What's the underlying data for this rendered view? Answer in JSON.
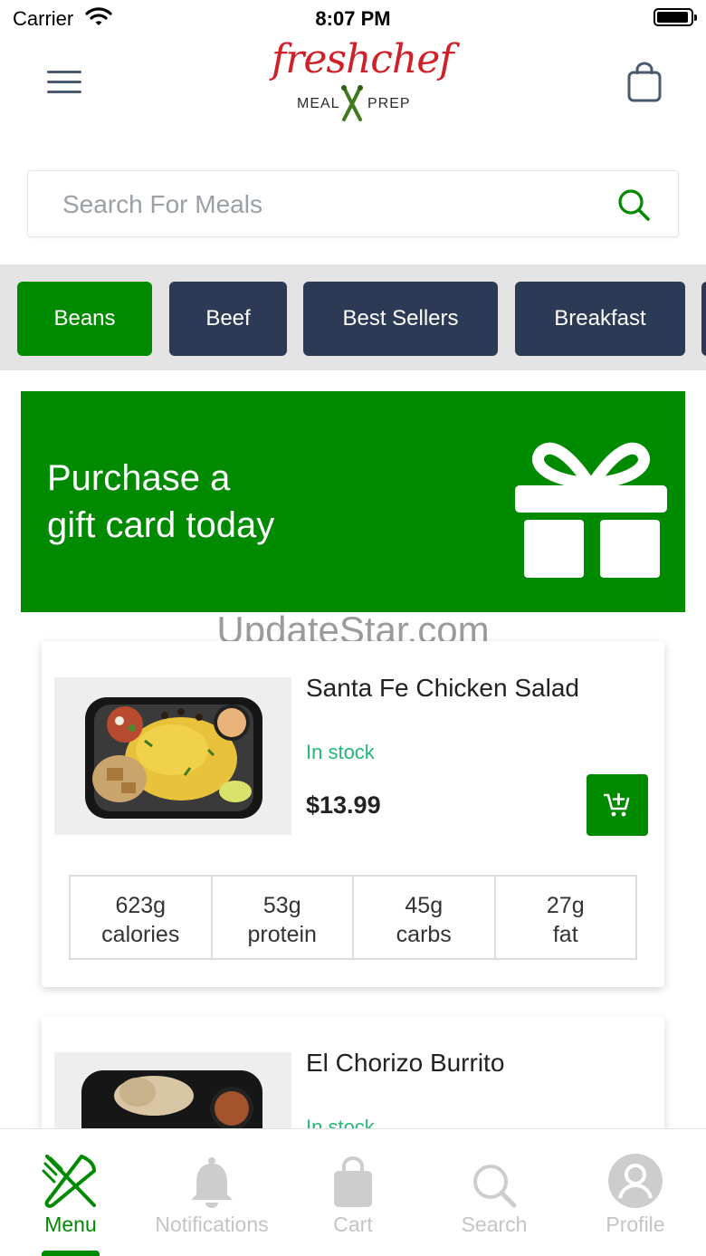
{
  "status_bar": {
    "carrier": "Carrier",
    "time": "8:07 PM"
  },
  "header": {
    "logo_text": "freshchef",
    "logo_sub_left": "MEAL",
    "logo_sub_right": "PREP"
  },
  "search": {
    "placeholder": "Search For Meals",
    "value": ""
  },
  "categories": [
    {
      "label": "Beans",
      "active": true
    },
    {
      "label": "Beef",
      "active": false
    },
    {
      "label": "Best Sellers",
      "active": false
    },
    {
      "label": "Breakfast",
      "active": false
    }
  ],
  "gift_banner": {
    "line1": "Purchase a",
    "line2": "gift card today"
  },
  "watermark": "UpdateStar.com",
  "meals": [
    {
      "name": "Santa Fe Chicken Salad",
      "stock": "In stock",
      "price": "$13.99",
      "macros": [
        {
          "value": "623g",
          "label": "calories"
        },
        {
          "value": "53g",
          "label": "protein"
        },
        {
          "value": "45g",
          "label": "carbs"
        },
        {
          "value": "27g",
          "label": "fat"
        }
      ]
    },
    {
      "name": "El Chorizo Burrito",
      "stock": "In stock"
    }
  ],
  "tabbar": {
    "items": [
      {
        "label": "Menu",
        "icon": "fork-knife-icon",
        "active": true
      },
      {
        "label": "Notifications",
        "icon": "bell-icon",
        "active": false
      },
      {
        "label": "Cart",
        "icon": "bag-icon",
        "active": false
      },
      {
        "label": "Search",
        "icon": "search-icon",
        "active": false
      },
      {
        "label": "Profile",
        "icon": "profile-icon",
        "active": false
      }
    ]
  },
  "colors": {
    "brand_green": "#008a00",
    "chip_navy": "#2c3a55",
    "stock_green": "#23b879",
    "logo_red": "#d0202a"
  }
}
